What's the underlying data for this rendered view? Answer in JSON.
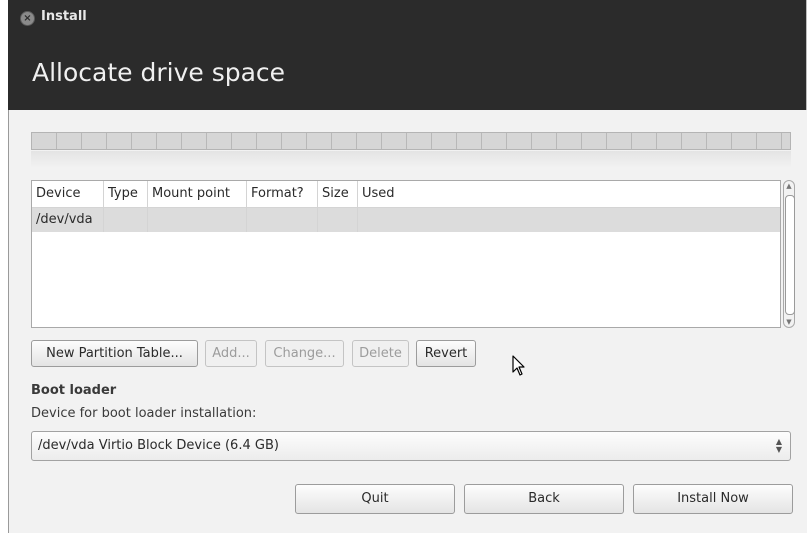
{
  "window": {
    "title": "Install"
  },
  "page": {
    "title": "Allocate drive space"
  },
  "table": {
    "columns": [
      "Device",
      "Type",
      "Mount point",
      "Format?",
      "Size",
      "Used"
    ],
    "rows": [
      {
        "device": "/dev/vda",
        "type": "",
        "mount": "",
        "format": "",
        "size": "",
        "used": ""
      }
    ]
  },
  "partition_buttons": {
    "new_table": "New Partition Table...",
    "add": "Add...",
    "change": "Change...",
    "delete": "Delete",
    "revert": "Revert"
  },
  "boot_loader": {
    "heading": "Boot loader",
    "label": "Device for boot loader installation:",
    "selected": "/dev/vda Virtio Block Device (6.4 GB)"
  },
  "footer_buttons": {
    "quit": "Quit",
    "back": "Back",
    "install": "Install Now"
  },
  "colors": {
    "titlebar": "#2b2b2b",
    "content_bg": "#f2f2f2",
    "selected_row": "#dcdcdc"
  }
}
